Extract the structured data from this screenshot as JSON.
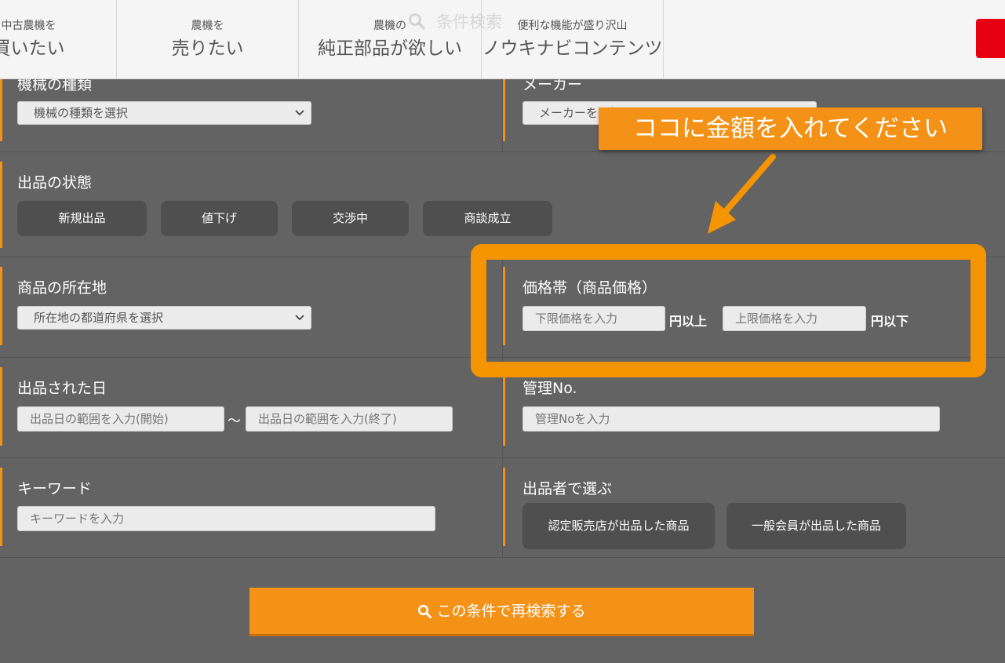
{
  "nav": {
    "items": [
      {
        "small": "中古農機を",
        "big": "買いたい"
      },
      {
        "small": "農機を",
        "big": "売りたい"
      },
      {
        "small": "農機の",
        "big": "純正部品が欲しい"
      },
      {
        "small": "便利な機能が盛り沢山",
        "big": "ノウキナビコンテンツ"
      }
    ]
  },
  "panel_title": "条件検索",
  "form": {
    "machine_type": {
      "label": "機械の種類",
      "placeholder": "機械の種類を選択"
    },
    "maker": {
      "label": "メーカー",
      "placeholder": "メーカーを選択"
    },
    "listing_status": {
      "label": "出品の状態",
      "options": [
        "新規出品",
        "値下げ",
        "交渉中",
        "商談成立"
      ]
    },
    "location": {
      "label": "商品の所在地",
      "placeholder": "所在地の都道府県を選択"
    },
    "price": {
      "label": "価格帯（商品価格）",
      "min_placeholder": "下限価格を入力",
      "min_suffix": "円以上",
      "max_placeholder": "上限価格を入力",
      "max_suffix": "円以下"
    },
    "listed_date": {
      "label": "出品された日",
      "start_placeholder": "出品日の範囲を入力(開始)",
      "separator": "～",
      "end_placeholder": "出品日の範囲を入力(終了)"
    },
    "management_no": {
      "label": "管理No.",
      "placeholder": "管理Noを入力"
    },
    "keyword": {
      "label": "キーワード",
      "placeholder": "キーワードを入力"
    },
    "seller": {
      "label": "出品者で選ぶ",
      "options": [
        "認定販売店が出品した商品",
        "一般会員が出品した商品"
      ]
    }
  },
  "search_button": {
    "label": "この条件で再検索する"
  },
  "annotation": {
    "callout_text": "ココに金額を入れてください"
  },
  "colors": {
    "accent": "#f39217",
    "highlight": "#f49400",
    "nav_red": "#e60012",
    "background": "#636363"
  }
}
